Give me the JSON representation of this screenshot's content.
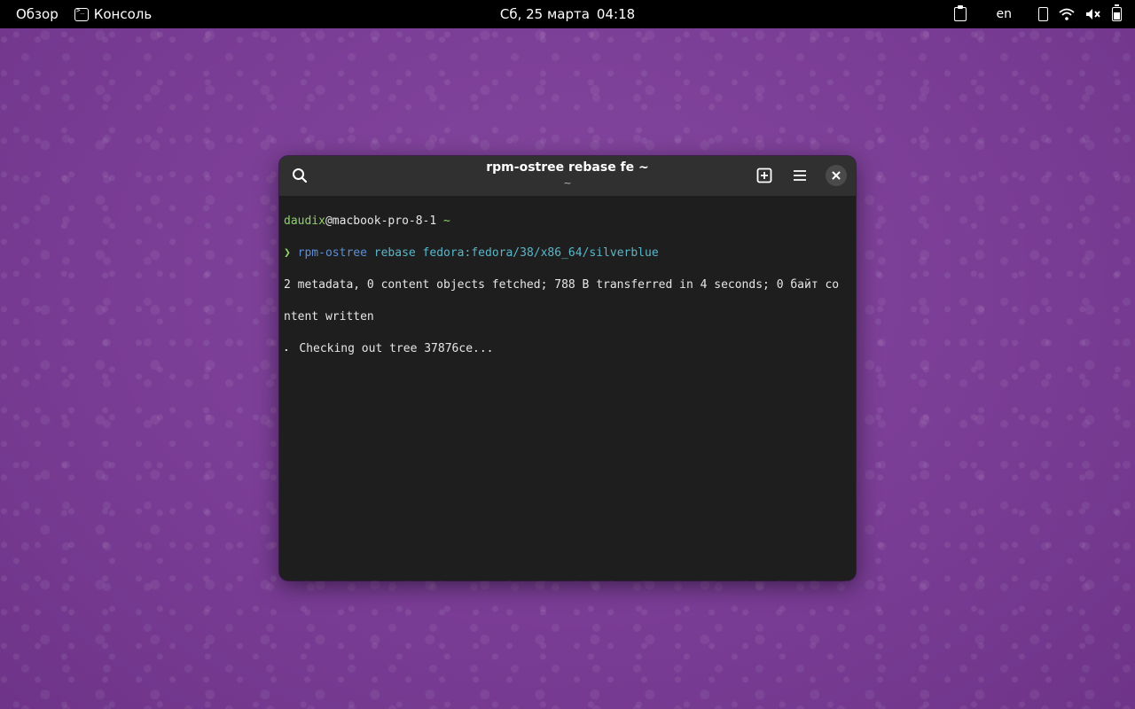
{
  "topbar": {
    "overview": "Обзор",
    "app_name": "Консоль",
    "date": "Сб, 25 марта",
    "time": "04:18",
    "input_lang": "en"
  },
  "window": {
    "title": "rpm-ostree rebase fe ~",
    "subtitle": "~"
  },
  "terminal": {
    "prompt_user": "daudix",
    "prompt_at": "@",
    "prompt_host": "macbook-pro-8-1",
    "prompt_dir": " ~",
    "prompt_symbol": "❯ ",
    "cmd_name": "rpm-ostree",
    "cmd_args": " rebase fedora:fedora/38/x86_64/silverblue",
    "output_line1": "2 metadata, 0 content objects fetched; 788 B transferred in 4 seconds; 0 байт co",
    "output_line2": "ntent written",
    "output_line3": "⠄ Checking out tree 37876ce..."
  },
  "colors": {
    "wallpaper": "#7a3d96",
    "topbar": "#000000",
    "terminal_bg": "#1e1e1e",
    "headerbar": "#303030",
    "prompt_green": "#8fd16b",
    "command_blue": "#5c8fd6",
    "args_cyan": "#59b7c9"
  },
  "icons": {
    "app": "terminal-icon",
    "clipboard": "clipboard-icon",
    "network": "wifi-icon",
    "sound": "volume-muted-icon",
    "battery": "battery-charging-icon",
    "search": "search-icon",
    "new_tab": "new-tab-icon",
    "menu": "hamburger-menu-icon",
    "close": "close-icon"
  }
}
